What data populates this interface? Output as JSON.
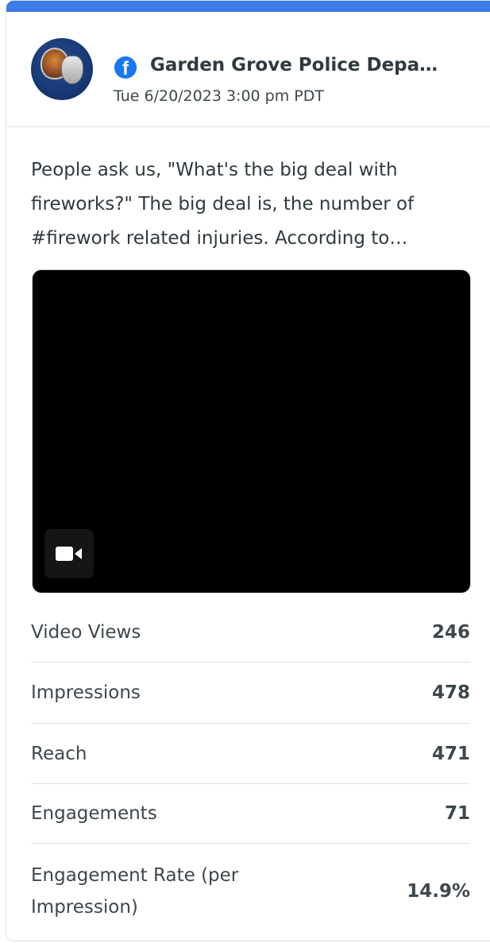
{
  "post": {
    "account_name": "Garden Grove Police Depa…",
    "platform_icon": "facebook-icon",
    "date": "Tue 6/20/2023 3:00 pm PDT",
    "text": "People ask us, \"What's the big deal with fireworks?\" The big deal is, the number of #firework related injuries. According to…",
    "media_type_icon": "video-camera-icon"
  },
  "stats": [
    {
      "label": "Video Views",
      "value": "246"
    },
    {
      "label": "Impressions",
      "value": "478"
    },
    {
      "label": "Reach",
      "value": "471"
    },
    {
      "label": "Engagements",
      "value": "71"
    },
    {
      "label": "Engagement Rate (per Impression)",
      "value": "14.9%"
    }
  ],
  "colors": {
    "accent": "#3b7bea",
    "facebook": "#1877f2"
  }
}
